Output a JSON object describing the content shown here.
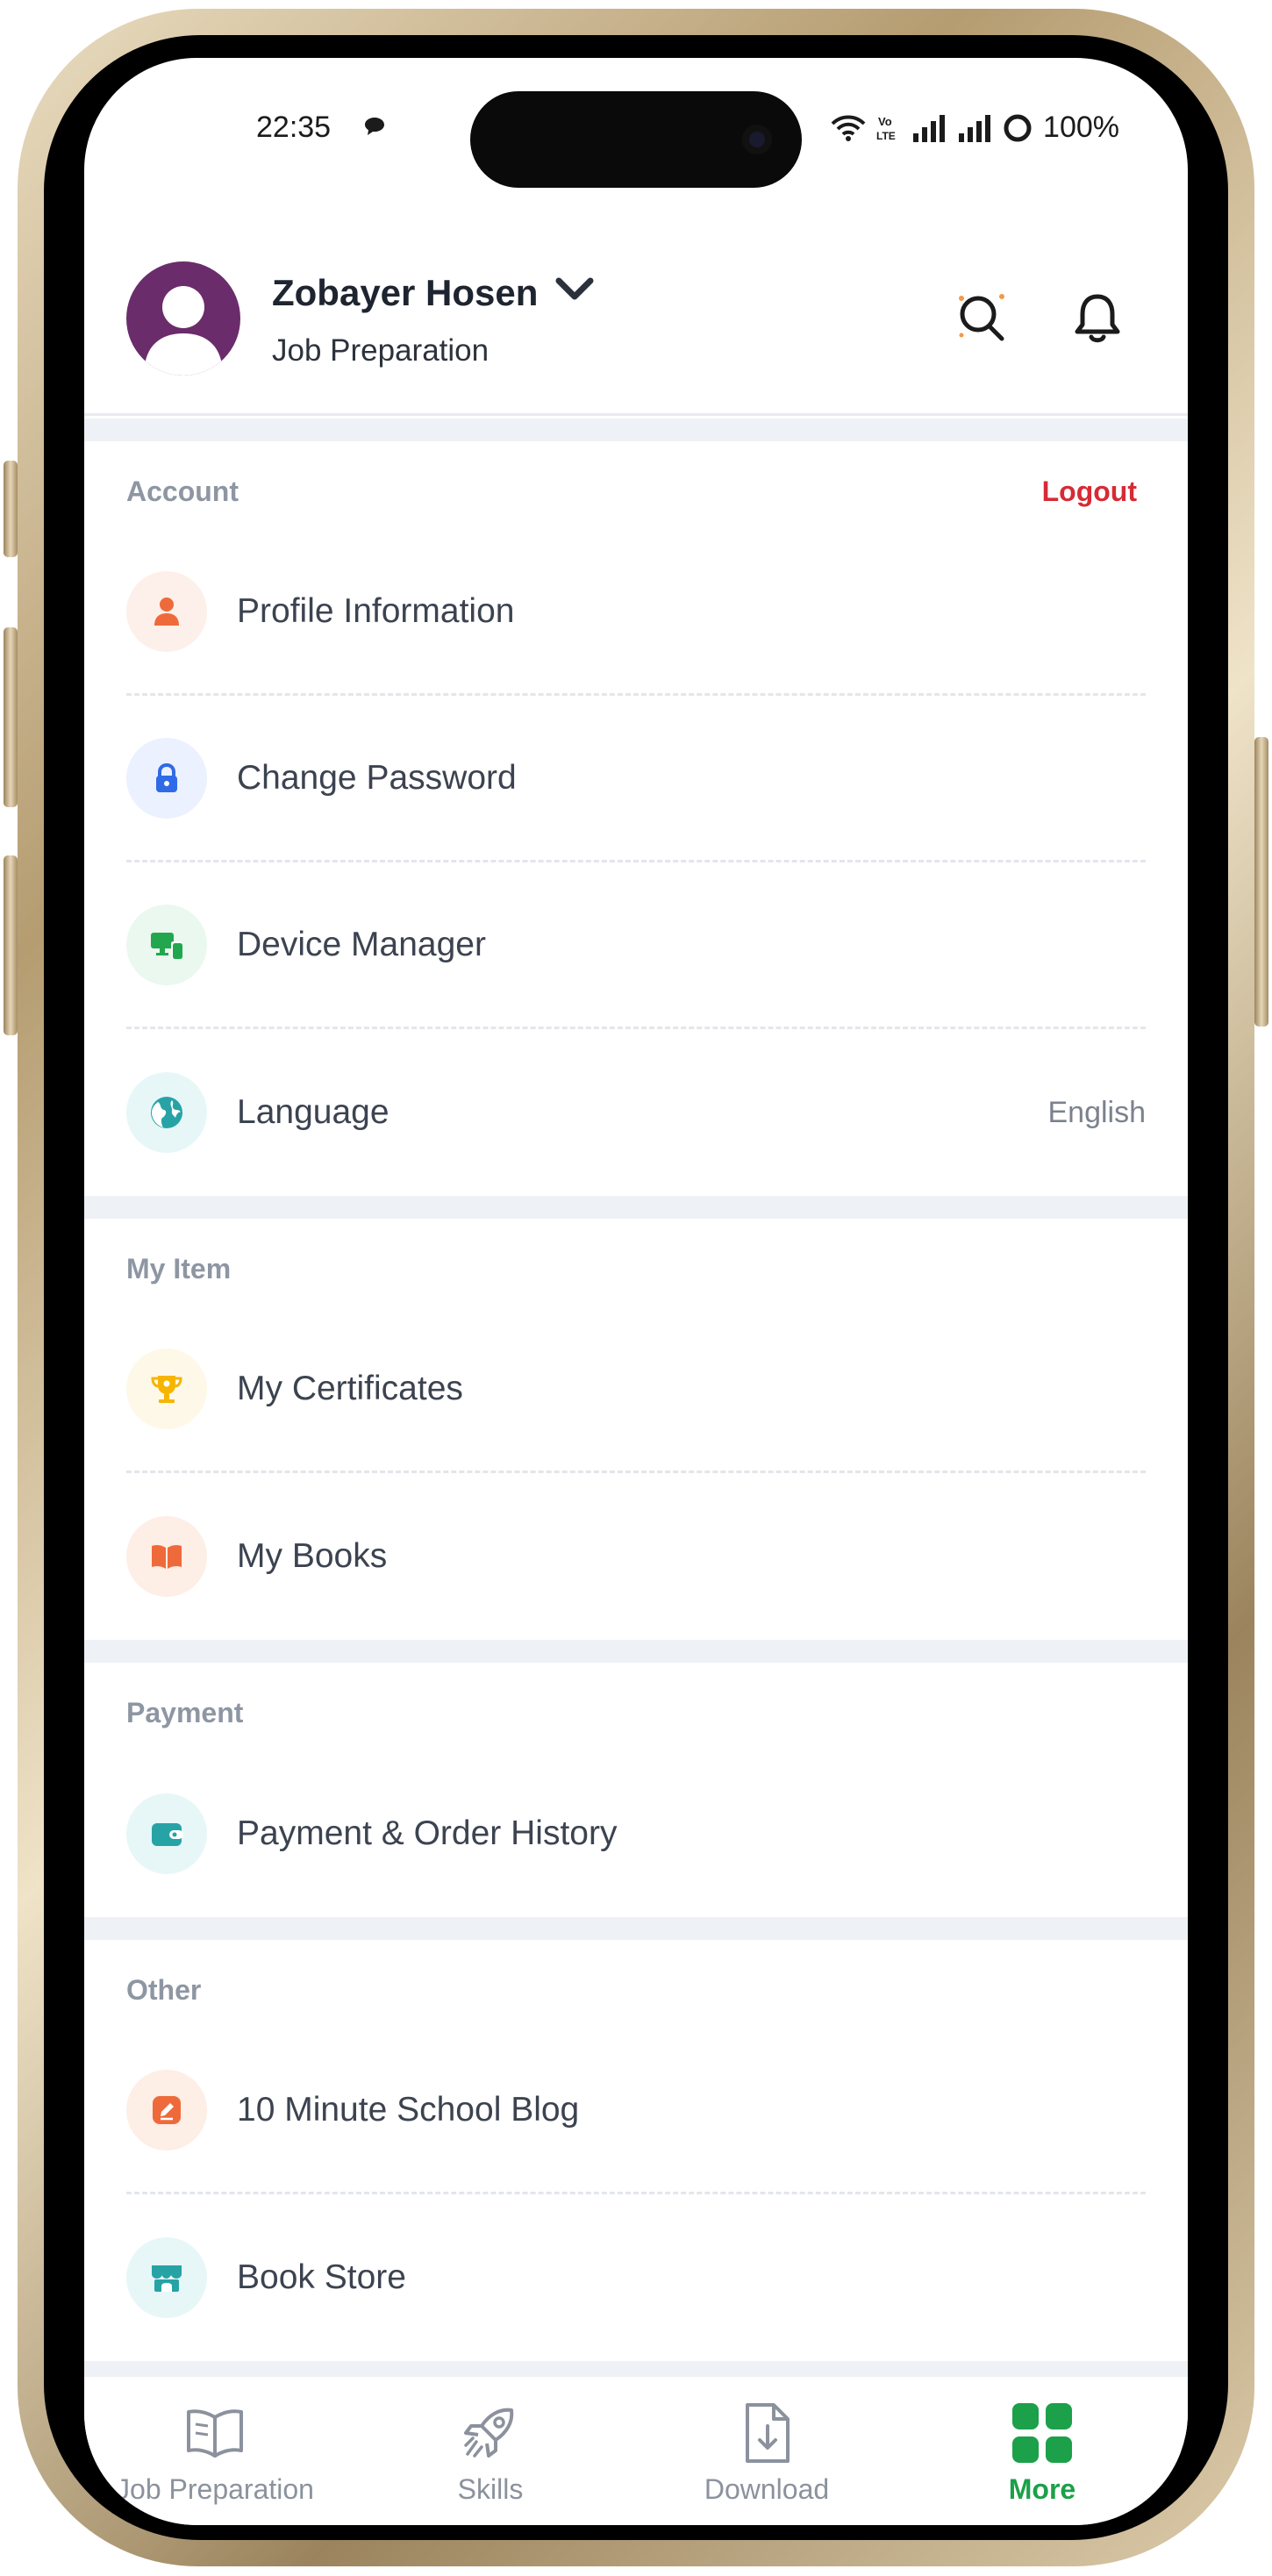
{
  "status_bar": {
    "time": "22:35",
    "battery": "100%"
  },
  "header": {
    "user_name": "Zobayer Hosen",
    "subtitle": "Job Preparation",
    "icons": [
      "avatar",
      "chevron-down-icon",
      "search-icon",
      "bell-icon"
    ]
  },
  "sections": {
    "account": {
      "title": "Account",
      "logout_label": "Logout",
      "items": [
        {
          "label": "Profile Information",
          "icon": "user-icon"
        },
        {
          "label": "Change Password",
          "icon": "lock-icon"
        },
        {
          "label": "Device Manager",
          "icon": "devices-icon"
        },
        {
          "label": "Language",
          "icon": "globe-icon",
          "value": "English"
        }
      ]
    },
    "my_item": {
      "title": "My Item",
      "items": [
        {
          "label": "My Certificates",
          "icon": "trophy-icon"
        },
        {
          "label": "My Books",
          "icon": "book-icon"
        }
      ]
    },
    "payment": {
      "title": "Payment",
      "items": [
        {
          "label": "Payment & Order History",
          "icon": "wallet-icon"
        }
      ]
    },
    "other": {
      "title": "Other",
      "items": [
        {
          "label": "10 Minute School Blog",
          "icon": "edit-icon"
        },
        {
          "label": "Book Store",
          "icon": "store-icon"
        }
      ]
    }
  },
  "bottom_nav": {
    "items": [
      {
        "label": "Job Preparation",
        "icon": "open-book-icon",
        "active": false
      },
      {
        "label": "Skills",
        "icon": "rocket-icon",
        "active": false
      },
      {
        "label": "Download",
        "icon": "download-file-icon",
        "active": false
      },
      {
        "label": "More",
        "icon": "grid-icon",
        "active": true
      }
    ]
  },
  "colors": {
    "accent_green": "#1ca04a",
    "logout_red": "#d62b35",
    "avatar_purple": "#6a2c6b",
    "muted_text": "#8e96a3"
  }
}
